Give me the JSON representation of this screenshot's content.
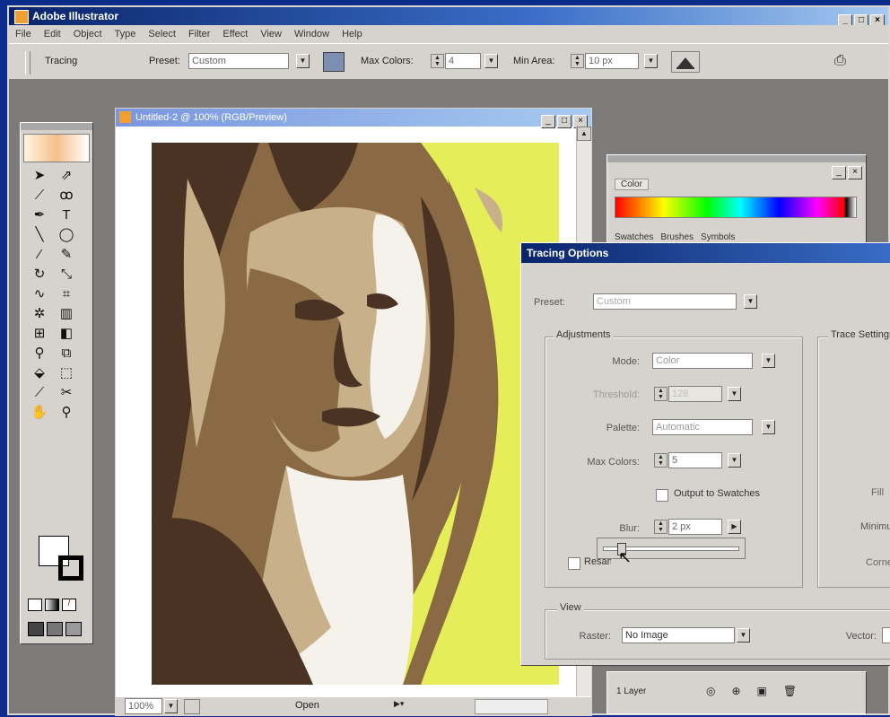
{
  "app": {
    "title": "Adobe Illustrator"
  },
  "menu": [
    "File",
    "Edit",
    "Object",
    "Type",
    "Select",
    "Filter",
    "Effect",
    "View",
    "Window",
    "Help"
  ],
  "control_bar": {
    "mode": "Tracing",
    "preset_label": "Preset:",
    "preset_value": "Custom",
    "max_colors_label": "Max Colors:",
    "max_colors_value": "4",
    "min_area_label": "Min Area:",
    "min_area_value": "10 px"
  },
  "document": {
    "title": "Untitled-2 @ 100% (RGB/Preview)",
    "zoom": "100%",
    "status": "Open"
  },
  "color_panel": {
    "title": "Color",
    "tabs": [
      "Swatches",
      "Brushes",
      "Symbols"
    ]
  },
  "layers_panel": {
    "label": "1 Layer"
  },
  "dialog": {
    "title": "Tracing Options",
    "preset_label": "Preset:",
    "preset_value": "Custom",
    "adjustments_label": "Adjustments",
    "mode_label": "Mode:",
    "mode_value": "Color",
    "threshold_label": "Threshold:",
    "threshold_value": "128",
    "palette_label": "Palette:",
    "palette_value": "Automatic",
    "max_colors_label": "Max Colors:",
    "max_colors_value": "5",
    "output_swatches_label": "Output to Swatches",
    "blur_label": "Blur:",
    "blur_value": "2 px",
    "resample_label": "Resample",
    "trace_settings_label": "Trace Settings",
    "fill_label": "Fill",
    "minimum_label": "Minimu",
    "corner_label": "Corner",
    "view_label": "View",
    "raster_label": "Raster:",
    "raster_value": "No Image",
    "vector_label": "Vector:"
  },
  "colors": {
    "desktop": "#0b2c8c",
    "artwork_yellow": "#e5ee58",
    "hair_dark": "#4a3322",
    "hair_mid": "#8a6a45",
    "skin_light": "#c8b08a",
    "highlight": "#f4f2ea"
  }
}
